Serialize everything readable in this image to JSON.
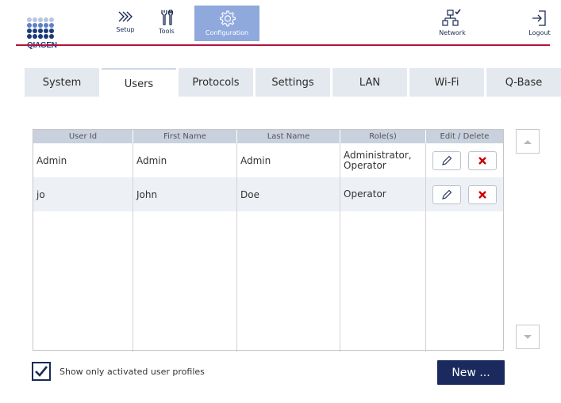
{
  "header": {
    "logo_text": "QIAGEN",
    "buttons": {
      "setup": "Setup",
      "tools": "Tools",
      "configuration": "Configuration",
      "network": "Network",
      "logout": "Logout"
    },
    "colors": {
      "brand_red": "#b4123a",
      "brand_blue": "#1b3a79",
      "active_button": "#8fa9dd"
    }
  },
  "tabs": [
    {
      "label": "System",
      "active": false
    },
    {
      "label": "Users",
      "active": true
    },
    {
      "label": "Protocols",
      "active": false
    },
    {
      "label": "Settings",
      "active": false
    },
    {
      "label": "LAN",
      "active": false
    },
    {
      "label": "Wi-Fi",
      "active": false
    },
    {
      "label": "Q-Base",
      "active": false
    }
  ],
  "table": {
    "columns": [
      "User Id",
      "First Name",
      "Last Name",
      "Role(s)",
      "Edit / Delete"
    ],
    "rows": [
      {
        "user_id": "Admin",
        "first_name": "Admin",
        "last_name": "Admin",
        "roles": "Administrator, Operator"
      },
      {
        "user_id": "jo",
        "first_name": "John",
        "last_name": "Doe",
        "roles": "Operator"
      }
    ],
    "icons": {
      "edit": "pencil-icon",
      "delete": "close-icon"
    }
  },
  "footer": {
    "checkbox_label": "Show only activated user profiles",
    "checkbox_checked": true,
    "new_button": "New ..."
  }
}
